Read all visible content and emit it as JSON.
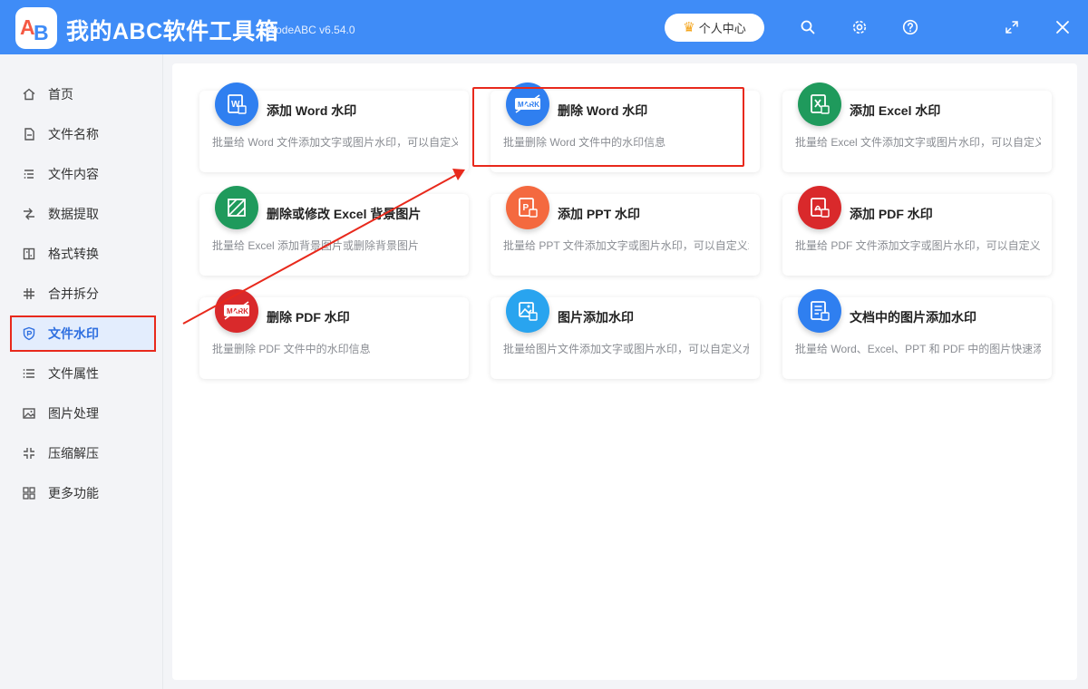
{
  "app": {
    "logo_a": "A",
    "logo_b": "B",
    "title": "我的ABC软件工具箱",
    "version": "WodeABC v6.54.0",
    "user_center": "个人中心"
  },
  "window_controls": [
    "search-icon",
    "gear-icon",
    "help-icon",
    "maximize-icon",
    "close-icon"
  ],
  "sidebar": {
    "items": [
      {
        "label": "首页",
        "icon": "home-icon",
        "active": false
      },
      {
        "label": "文件名称",
        "icon": "file-name-icon",
        "active": false
      },
      {
        "label": "文件内容",
        "icon": "file-content-icon",
        "active": false
      },
      {
        "label": "数据提取",
        "icon": "data-extract-icon",
        "active": false
      },
      {
        "label": "格式转换",
        "icon": "format-convert-icon",
        "active": false
      },
      {
        "label": "合并拆分",
        "icon": "merge-split-icon",
        "active": false
      },
      {
        "label": "文件水印",
        "icon": "watermark-icon",
        "active": true
      },
      {
        "label": "文件属性",
        "icon": "file-attr-icon",
        "active": false
      },
      {
        "label": "图片处理",
        "icon": "image-icon",
        "active": false
      },
      {
        "label": "压缩解压",
        "icon": "compress-icon",
        "active": false
      },
      {
        "label": "更多功能",
        "icon": "more-icon",
        "active": false
      }
    ]
  },
  "cards": [
    {
      "title": "添加 Word 水印",
      "desc": "批量给 Word 文件添加文字或图片水印，可以自定义",
      "icon": "word-icon",
      "color": "#2f7ff0"
    },
    {
      "title": "删除 Word 水印",
      "desc": "批量删除 Word 文件中的水印信息",
      "icon": "mark-icon",
      "color": "#2f7ff0",
      "glyph": "MARK"
    },
    {
      "title": "添加 Excel 水印",
      "desc": "批量给 Excel 文件添加文字或图片水印，可以自定义",
      "icon": "excel-icon",
      "color": "#1f9a5c"
    },
    {
      "title": "删除或修改 Excel 背景图片",
      "desc": "批量给 Excel 添加背景图片或删除背景图片",
      "icon": "excel-background-icon",
      "color": "#1f9a5c"
    },
    {
      "title": "添加 PPT 水印",
      "desc": "批量给 PPT 文件添加文字或图片水印，可以自定义水",
      "icon": "ppt-icon",
      "color": "#f4693f"
    },
    {
      "title": "添加 PDF 水印",
      "desc": "批量给 PDF 文件添加文字或图片水印，可以自定义水",
      "icon": "pdf-icon",
      "color": "#d9292b"
    },
    {
      "title": "删除 PDF 水印",
      "desc": "批量删除 PDF 文件中的水印信息",
      "icon": "mark-icon",
      "color": "#d9292b",
      "glyph": "MARK"
    },
    {
      "title": "图片添加水印",
      "desc": "批量给图片文件添加文字或图片水印，可以自定义水",
      "icon": "image-icon",
      "color": "#29a4ef"
    },
    {
      "title": "文档中的图片添加水印",
      "desc": "批量给 Word、Excel、PPT 和 PDF 中的图片快速添加",
      "icon": "doc-image-icon",
      "color": "#2f7ff0"
    }
  ]
}
